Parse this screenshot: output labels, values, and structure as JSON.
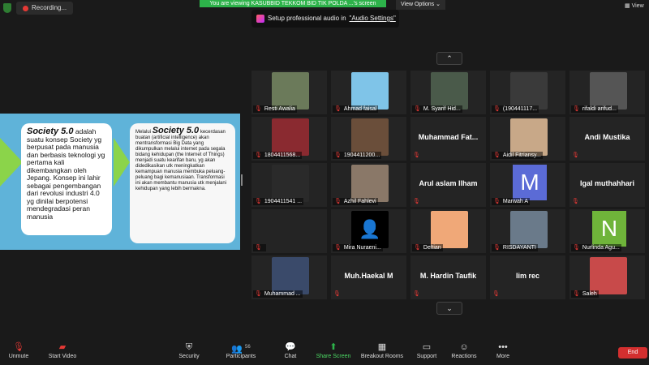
{
  "top": {
    "recording": "Recording...",
    "viewing": "You are viewing KASUBBID TEKKOM BID TIK POLDA ...'s screen",
    "view_options": "View Options",
    "view": "View"
  },
  "audio_tip": {
    "prefix": "Setup professional audio in ",
    "link": "\"Audio Settings\""
  },
  "slide": {
    "left_keyword": "Society 5.0",
    "left_text": "adalah suatu konsep Society yg berpusat pada manusia dan berbasis teknologi yg pertama kali dikembangkan oleh Jepang. Konsep ini lahir sebagai pengembangan dari revolusi industri 4.0 yg dinilai berpotensi mendegradasi peran manusia",
    "right_prefix": "Melalui",
    "right_keyword": "Society 5.0",
    "right_text": "kecerdasan buatan (artificial intelligence) akan mentransformasi Big Data yang dikumpulkan melalui internet pada segala bidang kehidupan (the Internet of Things) menjadi suatu kearifan baru, yg akan didedikasikan utk meningkatkan kemampuan manusia membuka peluang-peluang bagi kemanusiaan. Transformasi ini akan membantu manusia utk menjalani kehidupan yang lebih bermakna."
  },
  "tiles": [
    {
      "name": "Resti Awalia",
      "type": "photo",
      "color": "#6b7a5a"
    },
    {
      "name": "Ahmad faisal",
      "type": "photo",
      "color": "#7fc4e8"
    },
    {
      "name": "M. Syarif Hid...",
      "type": "photo",
      "color": "#4a5a4a"
    },
    {
      "name": "(190441117...",
      "type": "photo",
      "color": "#3a3a3a"
    },
    {
      "name": "rifaldi arifud...",
      "type": "photo",
      "color": "#555555"
    },
    {
      "name": "1804411568...",
      "type": "photo",
      "color": "#8a2a30"
    },
    {
      "name": "1904411200...",
      "type": "photo",
      "color": "#6a4e3a"
    },
    {
      "name": "Muhammad Fat...",
      "type": "text"
    },
    {
      "name": "Aidil Fitriansy...",
      "type": "photo",
      "color": "#c8a888"
    },
    {
      "name": "Andi Mustika",
      "type": "text"
    },
    {
      "name": "1904411541 ...",
      "type": "photo",
      "color": "#2a2a2a"
    },
    {
      "name": "Azhil Fahlevi",
      "type": "photo",
      "color": "#8a7868"
    },
    {
      "name": "Arul aslam Ilham",
      "type": "text"
    },
    {
      "name": "Marwah A",
      "type": "letter",
      "letter": "M",
      "color": "#5b6bd6"
    },
    {
      "name": "Igal muthahhari",
      "type": "text"
    },
    {
      "name": "",
      "type": "blank"
    },
    {
      "name": "Mira Nuraeni...",
      "type": "avatar",
      "color": "#000000"
    },
    {
      "name": "Deltian",
      "type": "photo",
      "color": "#f0a878"
    },
    {
      "name": "RISDAYANTI",
      "type": "photo",
      "color": "#6a7a8a"
    },
    {
      "name": "Nurlinda Agu...",
      "type": "letter",
      "letter": "N",
      "color": "#6fb43a"
    },
    {
      "name": "Muhammad ...",
      "type": "photo",
      "color": "#3a4a6a"
    },
    {
      "name": "Muh.Haekal M",
      "type": "text"
    },
    {
      "name": "M. Hardin Taufik",
      "type": "text"
    },
    {
      "name": "lim rec",
      "type": "text"
    },
    {
      "name": "Saleh",
      "type": "photo",
      "color": "#c84a4a"
    }
  ],
  "toolbar": {
    "unmute": "Unmute",
    "start_video": "Start Video",
    "security": "Security",
    "participants": "Participants",
    "participants_count": "56",
    "chat": "Chat",
    "share_screen": "Share Screen",
    "breakout": "Breakout Rooms",
    "support": "Support",
    "reactions": "Reactions",
    "more": "More",
    "end": "End"
  }
}
